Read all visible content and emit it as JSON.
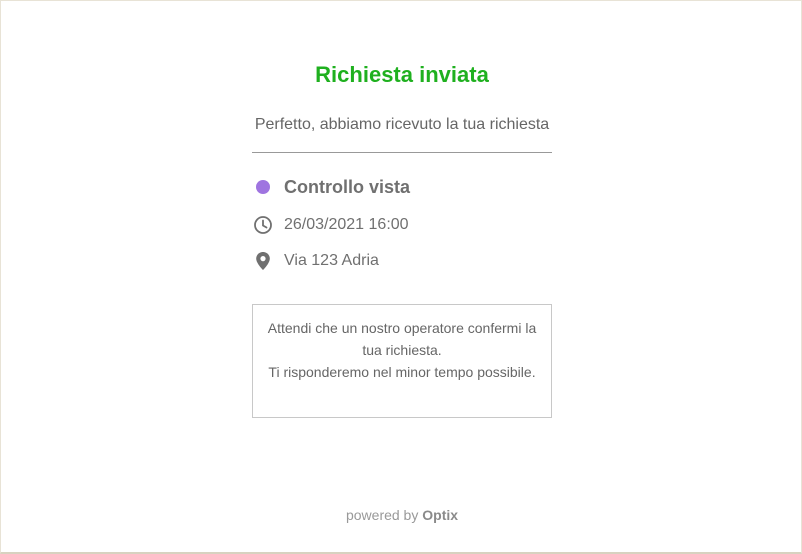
{
  "header": {
    "title": "Richiesta inviata",
    "subtitle": "Perfetto, abbiamo ricevuto la tua richiesta"
  },
  "appointment": {
    "service": "Controllo vista",
    "service_color": "#9f74e0",
    "service_icon": "dot-icon",
    "datetime": "26/03/2021 16:00",
    "datetime_icon": "clock-icon",
    "address": "Via 123 Adria",
    "address_icon": "location-pin-icon"
  },
  "notice": {
    "line1": "Attendi che un nostro operatore confermi la tua richiesta.",
    "line2": "Ti risponderemo nel minor tempo possibile."
  },
  "footer": {
    "powered_by": "powered by",
    "brand": "Optix"
  },
  "colors": {
    "title": "#1fb01f",
    "text": "#707070"
  }
}
